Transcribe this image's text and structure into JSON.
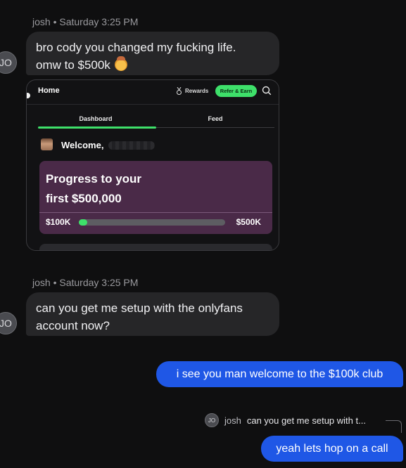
{
  "messages": [
    {
      "sender": "josh",
      "time": "Saturday 3:25 PM",
      "avatar": "JO",
      "line1": "bro cody you changed my fucking life.",
      "line2": "omw to $500k",
      "emoji": "cowboy-face-emoji"
    },
    {
      "sender": "josh",
      "time": "Saturday 3:25 PM",
      "avatar": "JO",
      "line1": "can you get me setup with the onlyfans",
      "line2": "account now?"
    }
  ],
  "screenshot": {
    "header": {
      "home": "Home",
      "rewards": "Rewards",
      "refer": "Refer & Earn",
      "icons": [
        "medal-icon",
        "search-icon"
      ]
    },
    "tabs": [
      "Dashboard",
      "Feed"
    ],
    "welcome": "Welcome,",
    "progress_card": {
      "title_line1": "Progress to your",
      "title_line2": "first $500,000",
      "start_label": "$100K",
      "end_label": "$500K",
      "progress_fraction": 0.06
    },
    "accent": "#3ee06a",
    "card_color": "#4a2a48"
  },
  "outgoing": [
    {
      "text": "i see you man welcome to the $100k club"
    },
    {
      "text": "yeah lets hop on a call"
    }
  ],
  "reply_ref": {
    "avatar": "JO",
    "name": "josh",
    "text": "can you get me setup with t..."
  },
  "colors": {
    "outgoing_bubble": "#1f57e6",
    "incoming_bubble": "#262628",
    "background": "#0f0f10"
  }
}
